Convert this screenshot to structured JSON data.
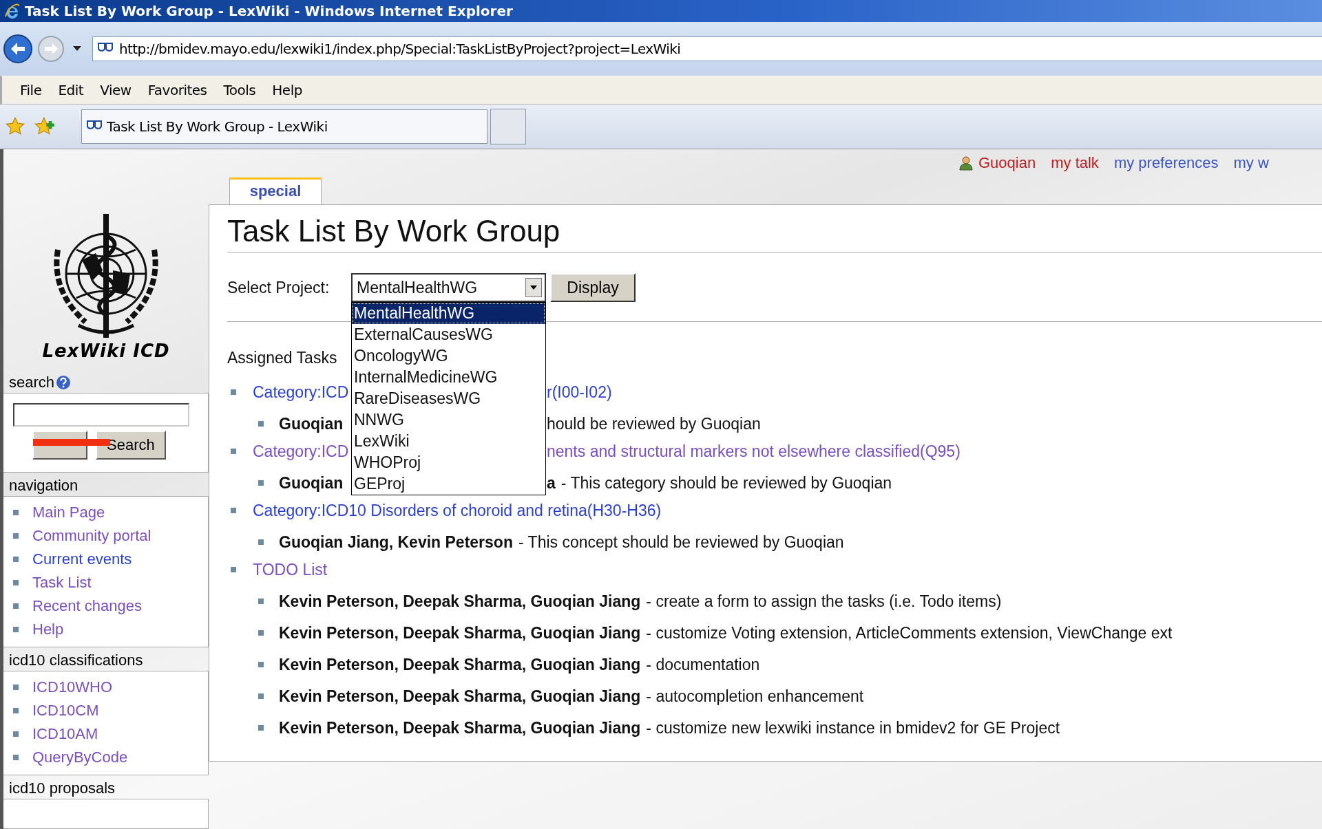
{
  "window": {
    "title": "Task List By Work Group - LexWiki - Windows Internet Explorer"
  },
  "address_bar": {
    "url": "http://bmidev.mayo.edu/lexwiki1/index.php/Special:TaskListByProject?project=LexWiki"
  },
  "menu": [
    "File",
    "Edit",
    "View",
    "Favorites",
    "Tools",
    "Help"
  ],
  "browser_tab": {
    "title": "Task List By Work Group - LexWiki"
  },
  "user_link": {
    "label": "Guoqian",
    "new_page": true
  },
  "personal_links": [
    {
      "label": "my talk",
      "new_page": true
    },
    {
      "label": "my preferences",
      "new_page": false
    },
    {
      "label": "my w",
      "new_page": false
    }
  ],
  "page_tab": {
    "label": "special",
    "selected": true
  },
  "sidebar": {
    "logo_text": "LexWiki ICD",
    "search": {
      "heading": "search",
      "search_button": "Search"
    },
    "portlets": [
      {
        "heading": "navigation",
        "items": [
          {
            "label": "Main Page",
            "visited": true
          },
          {
            "label": "Community portal",
            "visited": true
          },
          {
            "label": "Current events",
            "visited": false
          },
          {
            "label": "Task List",
            "visited": true
          },
          {
            "label": "Recent changes",
            "visited": true
          },
          {
            "label": "Help",
            "visited": true
          }
        ]
      },
      {
        "heading": "icd10 classifications",
        "items": [
          {
            "label": "ICD10WHO",
            "visited": true
          },
          {
            "label": "ICD10CM",
            "visited": true
          },
          {
            "label": "ICD10AM",
            "visited": true
          },
          {
            "label": "QueryByCode",
            "visited": true
          }
        ]
      },
      {
        "heading": "icd10 proposals"
      }
    ]
  },
  "heading": "Task List By Work Group",
  "project_select": {
    "label": "Select Project:",
    "value": "MentalHealthWG",
    "button": "Display",
    "expanded": true,
    "options": [
      {
        "label": "MentalHealthWG",
        "selected": true
      },
      {
        "label": "ExternalCausesWG",
        "selected": false
      },
      {
        "label": "OncologyWG",
        "selected": false
      },
      {
        "label": "InternalMedicineWG",
        "selected": false
      },
      {
        "label": "RareDiseasesWG",
        "selected": false
      },
      {
        "label": "NNWG",
        "selected": false
      },
      {
        "label": "LexWiki",
        "selected": false
      },
      {
        "label": "WHOProj",
        "selected": false
      },
      {
        "label": "GEProj",
        "selected": false
      }
    ]
  },
  "assigned_heading": "Assigned Tasks",
  "tasks": [
    {
      "text": "Category:ICD",
      "after_list": "r(I00-I02)",
      "visited": false,
      "children": [
        {
          "assignees": "Guoqian",
          "after_list": {
            "description": "hould be reviewed by Guoqian"
          }
        }
      ]
    },
    {
      "text": "Category:ICD",
      "after_list": "nents and structural markers not elsewhere classified(Q95)",
      "visited": true,
      "children": [
        {
          "assignees": "Guoqian",
          "after_list": {
            "assignees": "a",
            "description": "- This category should be reviewed by Guoqian"
          }
        }
      ]
    },
    {
      "text": "Category:ICD10 Disorders of choroid and retina(H30-H36)",
      "visited": false,
      "children": [
        {
          "assignees": "Guoqian Jiang, Kevin Peterson",
          "description": "- This concept should be reviewed by Guoqian"
        }
      ]
    },
    {
      "text": "TODO List",
      "visited": true,
      "children": [
        {
          "assignees": "Kevin Peterson, Deepak Sharma, Guoqian Jiang",
          "description": "- create a form to assign the tasks (i.e. Todo items)"
        },
        {
          "assignees": "Kevin Peterson, Deepak Sharma, Guoqian Jiang",
          "description": "- customize Voting extension, ArticleComments extension, ViewChange ext"
        },
        {
          "assignees": "Kevin Peterson, Deepak Sharma, Guoqian Jiang",
          "description": "- documentation"
        },
        {
          "assignees": "Kevin Peterson, Deepak Sharma, Guoqian Jiang",
          "description": "- autocompletion enhancement"
        },
        {
          "assignees": "Kevin Peterson, Deepak Sharma, Guoqian Jiang",
          "description": "- customize new lexwiki instance in bmidev2 for GE Project"
        }
      ]
    }
  ]
}
